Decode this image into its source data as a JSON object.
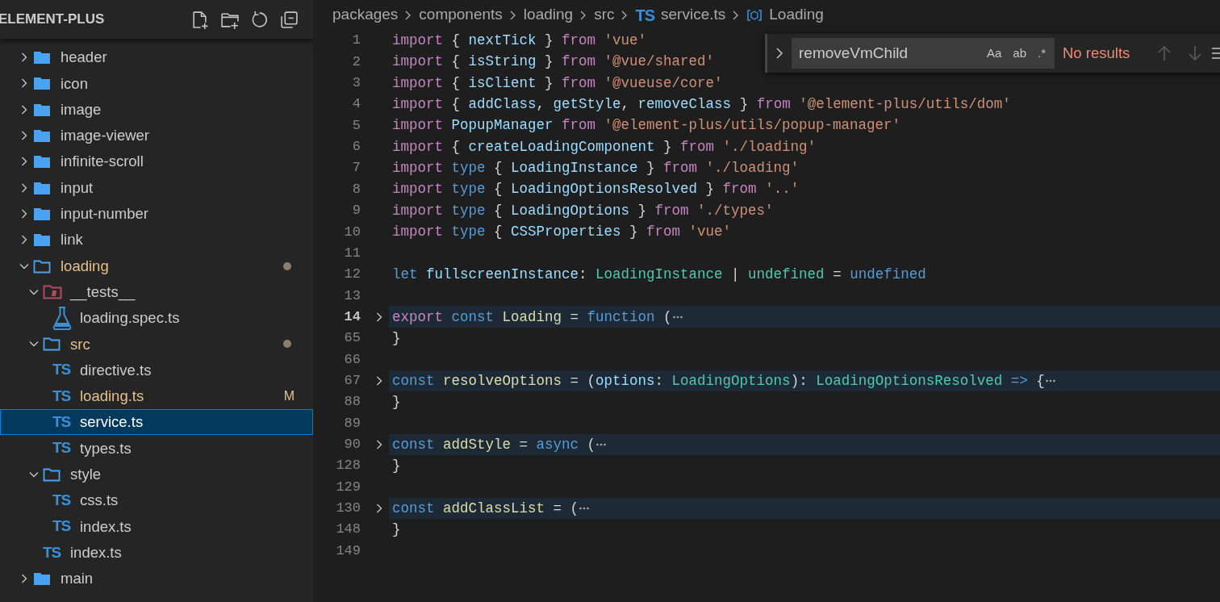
{
  "explorer": {
    "title": "ELEMENT-PLUS",
    "actions": [
      {
        "kind": "new-file"
      },
      {
        "kind": "new-folder"
      },
      {
        "kind": "refresh"
      },
      {
        "kind": "collapse"
      }
    ],
    "items": [
      {
        "name": "header",
        "kind": "folder",
        "expanded": false,
        "modified": false,
        "selected": false
      },
      {
        "name": "icon",
        "kind": "folder",
        "expanded": false,
        "modified": false,
        "selected": false
      },
      {
        "name": "image",
        "kind": "folder",
        "expanded": false,
        "modified": false,
        "selected": false
      },
      {
        "name": "image-viewer",
        "kind": "folder",
        "expanded": false,
        "modified": false,
        "selected": false
      },
      {
        "name": "infinite-scroll",
        "kind": "folder",
        "expanded": false,
        "modified": false,
        "selected": false
      },
      {
        "name": "input",
        "kind": "folder",
        "expanded": false,
        "modified": false,
        "selected": false
      },
      {
        "name": "input-number",
        "kind": "folder",
        "expanded": false,
        "modified": false,
        "selected": false
      },
      {
        "name": "link",
        "kind": "folder",
        "expanded": false,
        "modified": false,
        "selected": false
      },
      {
        "name": "loading",
        "kind": "folder",
        "expanded": true,
        "modified": true,
        "selected": false,
        "children": [
          {
            "name": "__tests__",
            "kind": "test-folder",
            "expanded": true,
            "modified": false,
            "selected": false,
            "children": [
              {
                "name": "loading.spec.ts",
                "kind": "test-file",
                "modified": false,
                "selected": false
              }
            ]
          },
          {
            "name": "src",
            "kind": "folder",
            "expanded": true,
            "modified": true,
            "selected": false,
            "children": [
              {
                "name": "directive.ts",
                "kind": "ts-file",
                "badge": "TS",
                "modified": false,
                "selected": false
              },
              {
                "name": "loading.ts",
                "kind": "ts-file",
                "badge": "TS",
                "modified": true,
                "status": "M",
                "selected": false
              },
              {
                "name": "service.ts",
                "kind": "ts-file",
                "badge": "TS",
                "modified": false,
                "selected": true
              },
              {
                "name": "types.ts",
                "kind": "ts-file",
                "badge": "TS",
                "modified": false,
                "selected": false
              }
            ]
          },
          {
            "name": "style",
            "kind": "folder",
            "expanded": true,
            "modified": false,
            "selected": false,
            "children": [
              {
                "name": "css.ts",
                "kind": "ts-file",
                "badge": "TS",
                "modified": false,
                "selected": false
              },
              {
                "name": "index.ts",
                "kind": "ts-file",
                "badge": "TS",
                "modified": false,
                "selected": false
              }
            ]
          },
          {
            "name": "index.ts",
            "kind": "ts-file",
            "badge": "TS",
            "modified": false,
            "selected": false
          }
        ]
      },
      {
        "name": "main",
        "kind": "folder",
        "expanded": false,
        "modified": false,
        "selected": false
      }
    ]
  },
  "breadcrumb": [
    {
      "label": "packages",
      "kind": "folder"
    },
    {
      "label": "components",
      "kind": "folder"
    },
    {
      "label": "loading",
      "kind": "folder"
    },
    {
      "label": "src",
      "kind": "folder"
    },
    {
      "label": "service.ts",
      "kind": "file",
      "badge": "TS"
    },
    {
      "label": "Loading",
      "kind": "symbol"
    }
  ],
  "find_widget": {
    "value": "removeVmChild",
    "toggles": [
      {
        "label": "Aa",
        "selected": false
      },
      {
        "label": "ab",
        "selected": false
      },
      {
        "label": ".*",
        "selected": false
      }
    ],
    "status": "No results",
    "previous_disabled": true,
    "next_disabled": true
  },
  "code": [
    {
      "number": "1",
      "current": false,
      "folded": false,
      "tokens": [
        {
          "kind": "keyword",
          "text": "import "
        },
        {
          "kind": "plain",
          "text": "{ "
        },
        {
          "kind": "variable",
          "text": "nextTick"
        },
        {
          "kind": "plain",
          "text": " } "
        },
        {
          "kind": "keyword",
          "text": "from "
        },
        {
          "kind": "string",
          "text": "'vue'"
        }
      ]
    },
    {
      "number": "2",
      "current": false,
      "folded": false,
      "tokens": [
        {
          "kind": "keyword",
          "text": "import "
        },
        {
          "kind": "plain",
          "text": "{ "
        },
        {
          "kind": "variable",
          "text": "isString"
        },
        {
          "kind": "plain",
          "text": " } "
        },
        {
          "kind": "keyword",
          "text": "from "
        },
        {
          "kind": "string",
          "text": "'@vue/shared'"
        }
      ]
    },
    {
      "number": "3",
      "current": false,
      "folded": false,
      "tokens": [
        {
          "kind": "keyword",
          "text": "import "
        },
        {
          "kind": "plain",
          "text": "{ "
        },
        {
          "kind": "variable",
          "text": "isClient"
        },
        {
          "kind": "plain",
          "text": " } "
        },
        {
          "kind": "keyword",
          "text": "from "
        },
        {
          "kind": "string",
          "text": "'@vueuse/core'"
        }
      ]
    },
    {
      "number": "4",
      "current": false,
      "folded": false,
      "tokens": [
        {
          "kind": "keyword",
          "text": "import "
        },
        {
          "kind": "plain",
          "text": "{ "
        },
        {
          "kind": "variable",
          "text": "addClass"
        },
        {
          "kind": "plain",
          "text": ", "
        },
        {
          "kind": "variable",
          "text": "getStyle"
        },
        {
          "kind": "plain",
          "text": ", "
        },
        {
          "kind": "variable",
          "text": "removeClass"
        },
        {
          "kind": "plain",
          "text": " } "
        },
        {
          "kind": "keyword",
          "text": "from "
        },
        {
          "kind": "string",
          "text": "'@element-plus/utils/dom'"
        }
      ]
    },
    {
      "number": "5",
      "current": false,
      "folded": false,
      "tokens": [
        {
          "kind": "keyword",
          "text": "import "
        },
        {
          "kind": "variable",
          "text": "PopupManager "
        },
        {
          "kind": "keyword",
          "text": "from "
        },
        {
          "kind": "string",
          "text": "'@element-plus/utils/popup-manager'"
        }
      ]
    },
    {
      "number": "6",
      "current": false,
      "folded": false,
      "tokens": [
        {
          "kind": "keyword",
          "text": "import "
        },
        {
          "kind": "plain",
          "text": "{ "
        },
        {
          "kind": "variable",
          "text": "createLoadingComponent"
        },
        {
          "kind": "plain",
          "text": " } "
        },
        {
          "kind": "keyword",
          "text": "from "
        },
        {
          "kind": "string",
          "text": "'./loading'"
        }
      ]
    },
    {
      "number": "7",
      "current": false,
      "folded": false,
      "tokens": [
        {
          "kind": "keyword",
          "text": "import "
        },
        {
          "kind": "storage",
          "text": "type "
        },
        {
          "kind": "plain",
          "text": "{ "
        },
        {
          "kind": "variable",
          "text": "LoadingInstance"
        },
        {
          "kind": "plain",
          "text": " } "
        },
        {
          "kind": "keyword",
          "text": "from "
        },
        {
          "kind": "string",
          "text": "'./loading'"
        }
      ]
    },
    {
      "number": "8",
      "current": false,
      "folded": false,
      "tokens": [
        {
          "kind": "keyword",
          "text": "import "
        },
        {
          "kind": "storage",
          "text": "type "
        },
        {
          "kind": "plain",
          "text": "{ "
        },
        {
          "kind": "variable",
          "text": "LoadingOptionsResolved"
        },
        {
          "kind": "plain",
          "text": " } "
        },
        {
          "kind": "keyword",
          "text": "from "
        },
        {
          "kind": "string",
          "text": "'..'"
        }
      ]
    },
    {
      "number": "9",
      "current": false,
      "folded": false,
      "tokens": [
        {
          "kind": "keyword",
          "text": "import "
        },
        {
          "kind": "storage",
          "text": "type "
        },
        {
          "kind": "plain",
          "text": "{ "
        },
        {
          "kind": "variable",
          "text": "LoadingOptions"
        },
        {
          "kind": "plain",
          "text": " } "
        },
        {
          "kind": "keyword",
          "text": "from "
        },
        {
          "kind": "string",
          "text": "'./types'"
        }
      ]
    },
    {
      "number": "10",
      "current": false,
      "folded": false,
      "tokens": [
        {
          "kind": "keyword",
          "text": "import "
        },
        {
          "kind": "storage",
          "text": "type "
        },
        {
          "kind": "plain",
          "text": "{ "
        },
        {
          "kind": "variable",
          "text": "CSSProperties"
        },
        {
          "kind": "plain",
          "text": " } "
        },
        {
          "kind": "keyword",
          "text": "from "
        },
        {
          "kind": "string",
          "text": "'vue'"
        }
      ]
    },
    {
      "number": "11",
      "current": false,
      "folded": false
    },
    {
      "number": "12",
      "current": false,
      "folded": false,
      "tokens": [
        {
          "kind": "storage",
          "text": "let "
        },
        {
          "kind": "variable",
          "text": "fullscreenInstance"
        },
        {
          "kind": "plain",
          "text": ": "
        },
        {
          "kind": "type",
          "text": "LoadingInstance"
        },
        {
          "kind": "plain",
          "text": " | "
        },
        {
          "kind": "type",
          "text": "undefined"
        },
        {
          "kind": "plain",
          "text": " = "
        },
        {
          "kind": "storage",
          "text": "undefined"
        }
      ]
    },
    {
      "number": "13",
      "current": false,
      "folded": false
    },
    {
      "number": "14",
      "current": true,
      "folded": true,
      "tokens": [
        {
          "kind": "keyword",
          "text": "export "
        },
        {
          "kind": "storage",
          "text": "const "
        },
        {
          "kind": "function",
          "text": "Loading"
        },
        {
          "kind": "plain",
          "text": " = "
        },
        {
          "kind": "storage",
          "text": "function "
        },
        {
          "kind": "plain",
          "text": "("
        }
      ]
    },
    {
      "number": "65",
      "current": false,
      "folded": false,
      "tokens": [
        {
          "kind": "plain",
          "text": "}"
        }
      ]
    },
    {
      "number": "66",
      "current": false,
      "folded": false
    },
    {
      "number": "67",
      "current": false,
      "folded": true,
      "tokens": [
        {
          "kind": "storage",
          "text": "const "
        },
        {
          "kind": "function",
          "text": "resolveOptions"
        },
        {
          "kind": "plain",
          "text": " = ("
        },
        {
          "kind": "variable",
          "text": "options"
        },
        {
          "kind": "plain",
          "text": ": "
        },
        {
          "kind": "type",
          "text": "LoadingOptions"
        },
        {
          "kind": "plain",
          "text": "): "
        },
        {
          "kind": "type",
          "text": "LoadingOptionsResolved "
        },
        {
          "kind": "storage",
          "text": "=> "
        },
        {
          "kind": "plain",
          "text": "{"
        }
      ]
    },
    {
      "number": "88",
      "current": false,
      "folded": false,
      "tokens": [
        {
          "kind": "plain",
          "text": "}"
        }
      ]
    },
    {
      "number": "89",
      "current": false,
      "folded": false
    },
    {
      "number": "90",
      "current": false,
      "folded": true,
      "tokens": [
        {
          "kind": "storage",
          "text": "const "
        },
        {
          "kind": "function",
          "text": "addStyle"
        },
        {
          "kind": "plain",
          "text": " = "
        },
        {
          "kind": "storage",
          "text": "async "
        },
        {
          "kind": "plain",
          "text": "("
        }
      ]
    },
    {
      "number": "128",
      "current": false,
      "folded": false,
      "tokens": [
        {
          "kind": "plain",
          "text": "}"
        }
      ]
    },
    {
      "number": "129",
      "current": false,
      "folded": false
    },
    {
      "number": "130",
      "current": false,
      "folded": true,
      "tokens": [
        {
          "kind": "storage",
          "text": "const "
        },
        {
          "kind": "function",
          "text": "addClassList"
        },
        {
          "kind": "plain",
          "text": " = ("
        }
      ]
    },
    {
      "number": "148",
      "current": false,
      "folded": false,
      "tokens": [
        {
          "kind": "plain",
          "text": "}"
        }
      ]
    },
    {
      "number": "149",
      "current": false,
      "folded": false
    }
  ]
}
